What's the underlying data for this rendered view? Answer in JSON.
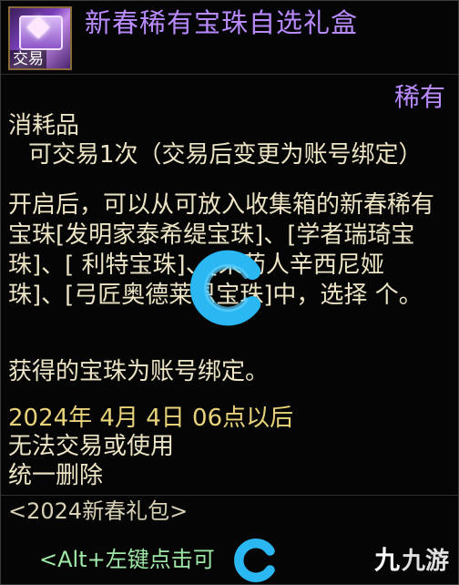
{
  "item": {
    "icon": "reward-box-icon",
    "trade_badge": "交易",
    "name": "新春稀有宝珠自选礼盒",
    "rarity": "稀有",
    "category": "消耗品",
    "trade_note": "可交易1次（交易后变更为账号绑定）",
    "description": "开启后，可以从可放入收集箱的新春稀有宝珠[发明家泰希缇宝珠]、[学者瑞琦宝珠]、[ 利特宝珠]、[采药人辛西尼娅 珠]、[弓匠奥德莱恩宝珠]中，选择 个。",
    "bound_note": "获得的宝珠为账号绑定。",
    "expire_note": "2024年 4月 4日 06点以后",
    "no_trade_note": "无法交易或使用",
    "delete_note": "统一删除",
    "package": "<2024新春礼包>",
    "hint": "<Alt+左键点击可"
  },
  "watermark": {
    "site_mark": "九",
    "site_name": "九游",
    "brand_colors": [
      "#2bb7f2",
      "#5fd0ff"
    ]
  },
  "colors": {
    "title": "#b98bff",
    "body": "#ece4c4",
    "date": "#e8d27a",
    "hint": "#9fe7a6",
    "background": "#050505"
  }
}
